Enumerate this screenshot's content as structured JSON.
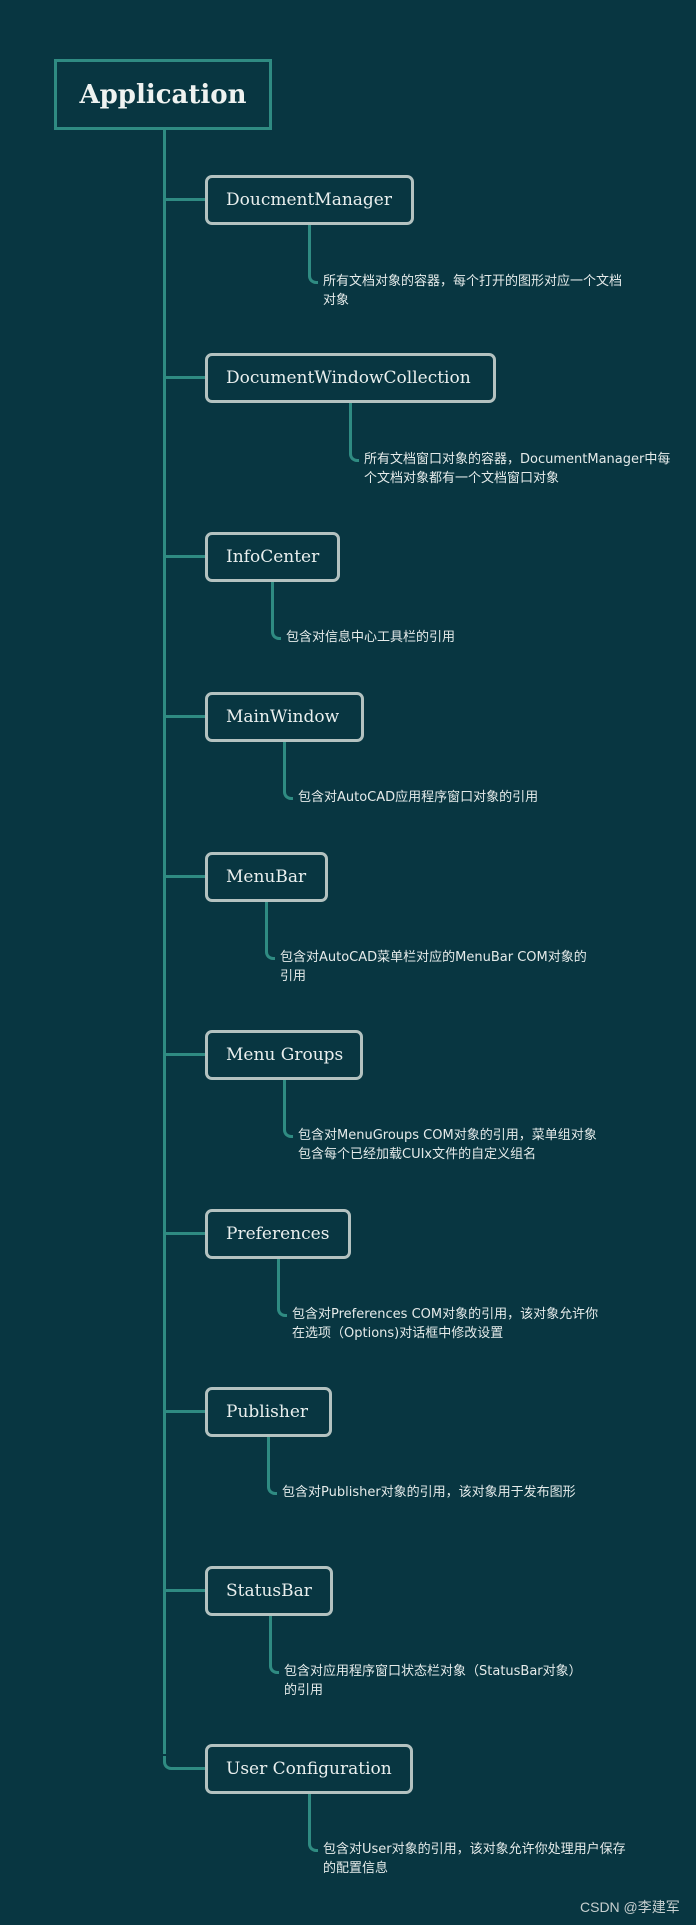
{
  "root": {
    "label": "Application"
  },
  "nodes": [
    {
      "label": "DoucmentManager",
      "description": "所有文档对象的容器，每个打开的图形对应一个文档对象"
    },
    {
      "label": "DocumentWindowCollection",
      "description": "所有文档窗口对象的容器，DocumentManager中每个文档对象都有一个文档窗口对象"
    },
    {
      "label": "InfoCenter",
      "description": "包含对信息中心工具栏的引用"
    },
    {
      "label": "MainWindow",
      "description": "包含对AutoCAD应用程序窗口对象的引用"
    },
    {
      "label": "MenuBar",
      "description": "包含对AutoCAD菜单栏对应的MenuBar COM对象的引用"
    },
    {
      "label": "Menu Groups",
      "description": "包含对MenuGroups COM对象的引用，菜单组对象包含每个已经加载CUIx文件的自定义组名"
    },
    {
      "label": "Preferences",
      "description": "包含对Preferences COM对象的引用，该对象允许你在选项（Options)对话框中修改设置"
    },
    {
      "label": "Publisher",
      "description": "包含对Publisher对象的引用，该对象用于发布图形"
    },
    {
      "label": "StatusBar",
      "description": "包含对应用程序窗口状态栏对象（StatusBar对象）的引用"
    },
    {
      "label": "User Configuration",
      "description": "包含对User对象的引用，该对象允许你处理用户保存的配置信息"
    }
  ],
  "watermark": "CSDN @李建军",
  "colors": {
    "background": "#083641",
    "connector": "#2f8b82",
    "node_border": "#b3c2c0",
    "text": "#e9efee"
  }
}
